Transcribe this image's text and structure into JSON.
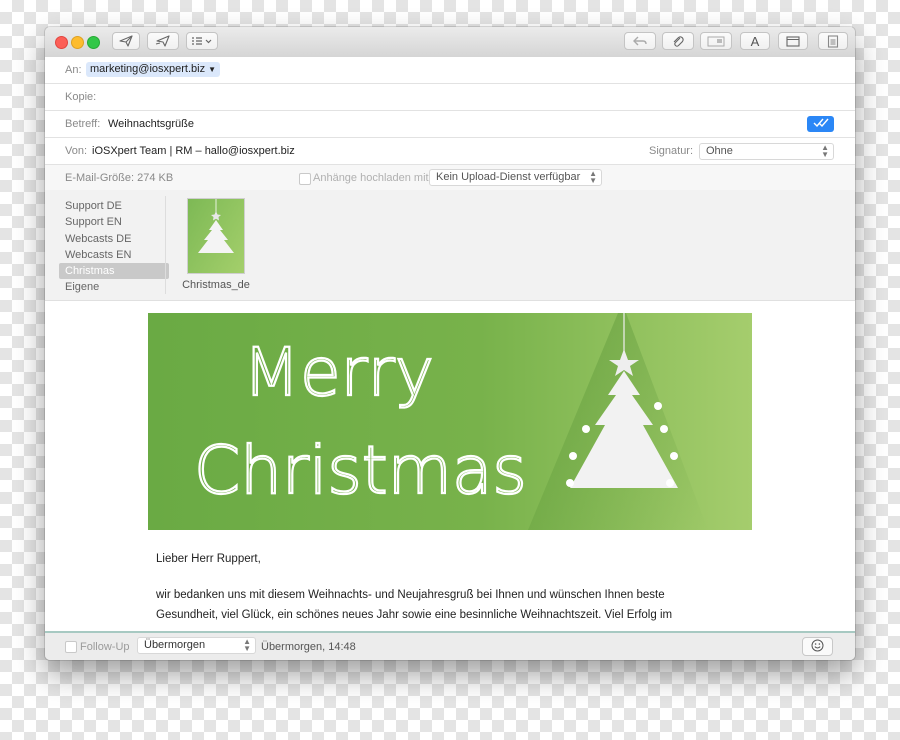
{
  "toolbar": {
    "send_icon": "paper-plane-icon",
    "flag_icon": "paper-plane-outline-icon",
    "list_icon": "list-dropdown-icon",
    "reply_icon": "reply-arrow-icon",
    "attach_icon": "paperclip-icon",
    "photo_icon": "photo-browser-icon",
    "format_label": "A",
    "window_icon": "window-icon",
    "stationery_icon": "stationery-icon"
  },
  "header": {
    "to_label": "An:",
    "to_value": "marketing@iosxpert.biz",
    "cc_label": "Kopie:",
    "subject_label": "Betreff:",
    "subject_value": "Weihnachtsgrüße",
    "from_label": "Von:",
    "from_value": "iOSXpert Team | RM – hallo@iosxpert.biz",
    "signature_label": "Signatur:",
    "signature_value": "Ohne",
    "size_label": "E-Mail-Größe:",
    "size_value": "274 KB",
    "upload_label": "Anhänge hochladen mit",
    "upload_value": "Kein Upload-Dienst verfügbar"
  },
  "stationery": {
    "categories": [
      "Support DE",
      "Support EN",
      "Webcasts DE",
      "Webcasts EN",
      "Christmas",
      "Eigene"
    ],
    "selected": "Christmas",
    "thumbnail_label": "Christmas_de"
  },
  "banner": {
    "line1": "Merry",
    "line2": "Christmas",
    "color_dark": "#6aaa44",
    "color_light": "#a5cd6d"
  },
  "body": {
    "greeting": "Lieber Herr Ruppert,",
    "paragraph": "wir bedanken uns mit diesem Weihnachts- und Neujahresgruß bei Ihnen und wünschen Ihnen beste Gesundheit, viel Glück, ein schönes neues Jahr sowie eine besinnliche Weihnachtszeit. Viel Erfolg im"
  },
  "footer": {
    "followup_label": "Follow-Up",
    "when_value": "Übermorgen",
    "when_detail": "Übermorgen, 14:48",
    "emoji_icon": "smiley-icon"
  }
}
